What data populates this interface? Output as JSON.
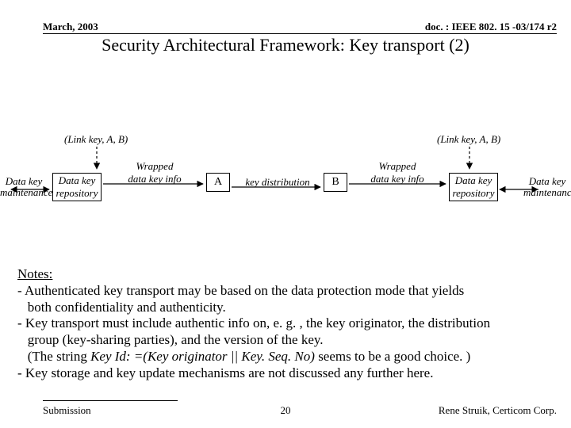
{
  "header": {
    "left": "March, 2003",
    "right": "doc. : IEEE 802. 15 -03/174 r2"
  },
  "title": "Security Architectural Framework: Key transport (2)",
  "diagram": {
    "caption_left": "(Link key, A, B)",
    "caption_right": "(Link key, A, B)",
    "left_node1": "Data key\nmaintenance",
    "left_node2": "Data key\nrepository",
    "right_node1": "Data key\nrepository",
    "right_node2": "Data key\nmaintenance",
    "arrow_left": "Wrapped\ndata key info",
    "arrow_mid": "key distribution",
    "arrow_right": "Wrapped\ndata key info",
    "A": "A",
    "B": "B"
  },
  "notes": {
    "heading": "Notes:",
    "l1": "- Authenticated key transport may be based on the data protection mode that yields",
    "l2": "   both confidentiality and authenticity.",
    "l3": "- Key transport must include authentic info on, e. g. , the key originator, the distribution",
    "l4": "   group (key-sharing parties), and the version of the key.",
    "l5a": "   (The string ",
    "l5b": "Key Id: =(Key originator || Key. Seq. No)",
    "l5c": " seems to be a good choice. )",
    "l6": "- Key storage and key update mechanisms are not discussed any further here."
  },
  "footer": {
    "left": "Submission",
    "center": "20",
    "right": "Rene Struik, Certicom Corp."
  }
}
